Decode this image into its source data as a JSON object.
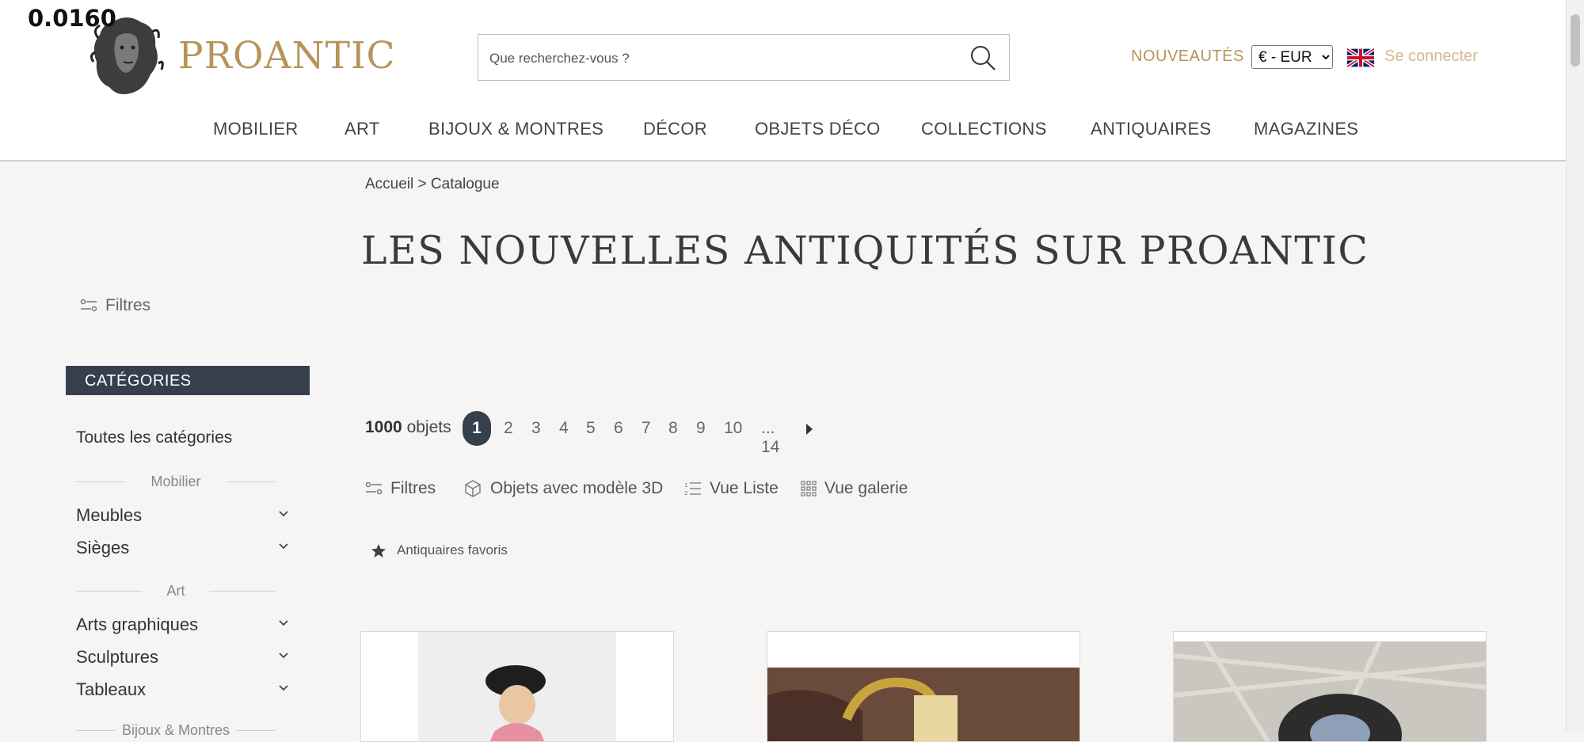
{
  "debug_value": "0.0160",
  "brand": {
    "name": "PROANTIC"
  },
  "search": {
    "placeholder": "Que recherchez-vous ?"
  },
  "header": {
    "new_label": "NOUVEAUTÉS",
    "currency_selected": "€ - EUR",
    "login_label": "Se connecter"
  },
  "nav": {
    "items": [
      "MOBILIER",
      "ART",
      "BIJOUX & MONTRES",
      "DÉCOR",
      "OBJETS DÉCO",
      "COLLECTIONS",
      "ANTIQUAIRES",
      "MAGAZINES"
    ]
  },
  "breadcrumb": {
    "home": "Accueil",
    "separator": ">",
    "current": "Catalogue"
  },
  "page_title": "LES NOUVELLES ANTIQUITÉS SUR PROANTIC",
  "sidebar": {
    "filters_label": "Filtres",
    "categories_title": "CATÉGORIES",
    "all_categories": "Toutes les catégories",
    "group_mobilier": "Mobilier",
    "group_art": "Art",
    "group_bijoux": "Bijoux & Montres",
    "items": [
      "Meubles",
      "Sièges",
      "Arts graphiques",
      "Sculptures",
      "Tableaux"
    ]
  },
  "results": {
    "count_number": "1000",
    "count_unit": "objets",
    "pages": [
      "1",
      "2",
      "3",
      "4",
      "5",
      "6",
      "7",
      "8",
      "9",
      "10",
      "... 14"
    ]
  },
  "toolbar": {
    "filters": "Filtres",
    "objects_3d": "Objets avec modèle 3D",
    "list_view": "Vue Liste",
    "gallery_view": "Vue galerie",
    "favorites": "Antiquaires favoris"
  },
  "colors": {
    "brand_gold": "#b8945a",
    "dark_navy": "#363f4e",
    "background": "#f6f5f3"
  }
}
